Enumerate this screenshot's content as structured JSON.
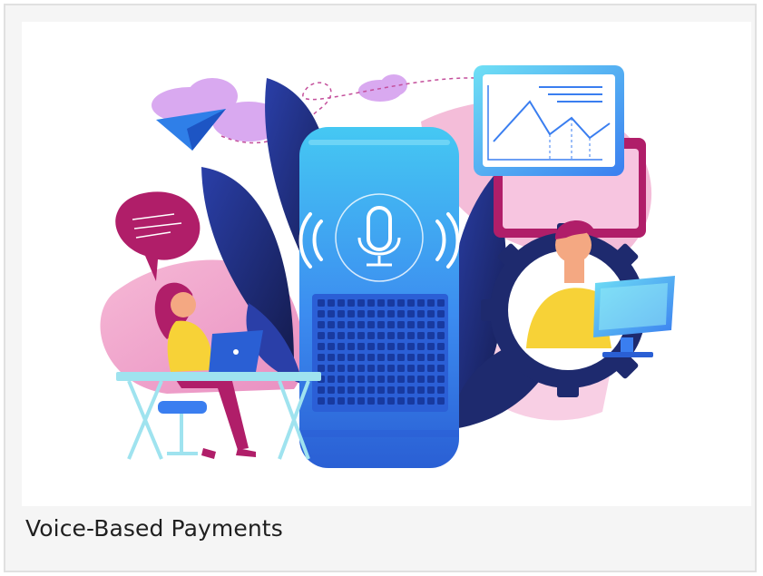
{
  "card": {
    "title": "Voice-Based Payments"
  },
  "illustration": {
    "icons": [
      "microphone-icon",
      "line-chart-icon",
      "paper-plane-icon",
      "speech-bubble-icon",
      "gear-icon",
      "laptop-icon",
      "monitor-icon"
    ],
    "colors": {
      "speaker_blue": "#3c8cf0",
      "speaker_dark": "#2a5fd4",
      "leaf_navy": "#1e2a6e",
      "blob_pink": "#f3a9cf",
      "cloud_lilac": "#d9a9f0",
      "bubble_magenta": "#b01e69",
      "shirt_yellow": "#f7d237",
      "desk_cyan": "#9fe3ef"
    }
  }
}
